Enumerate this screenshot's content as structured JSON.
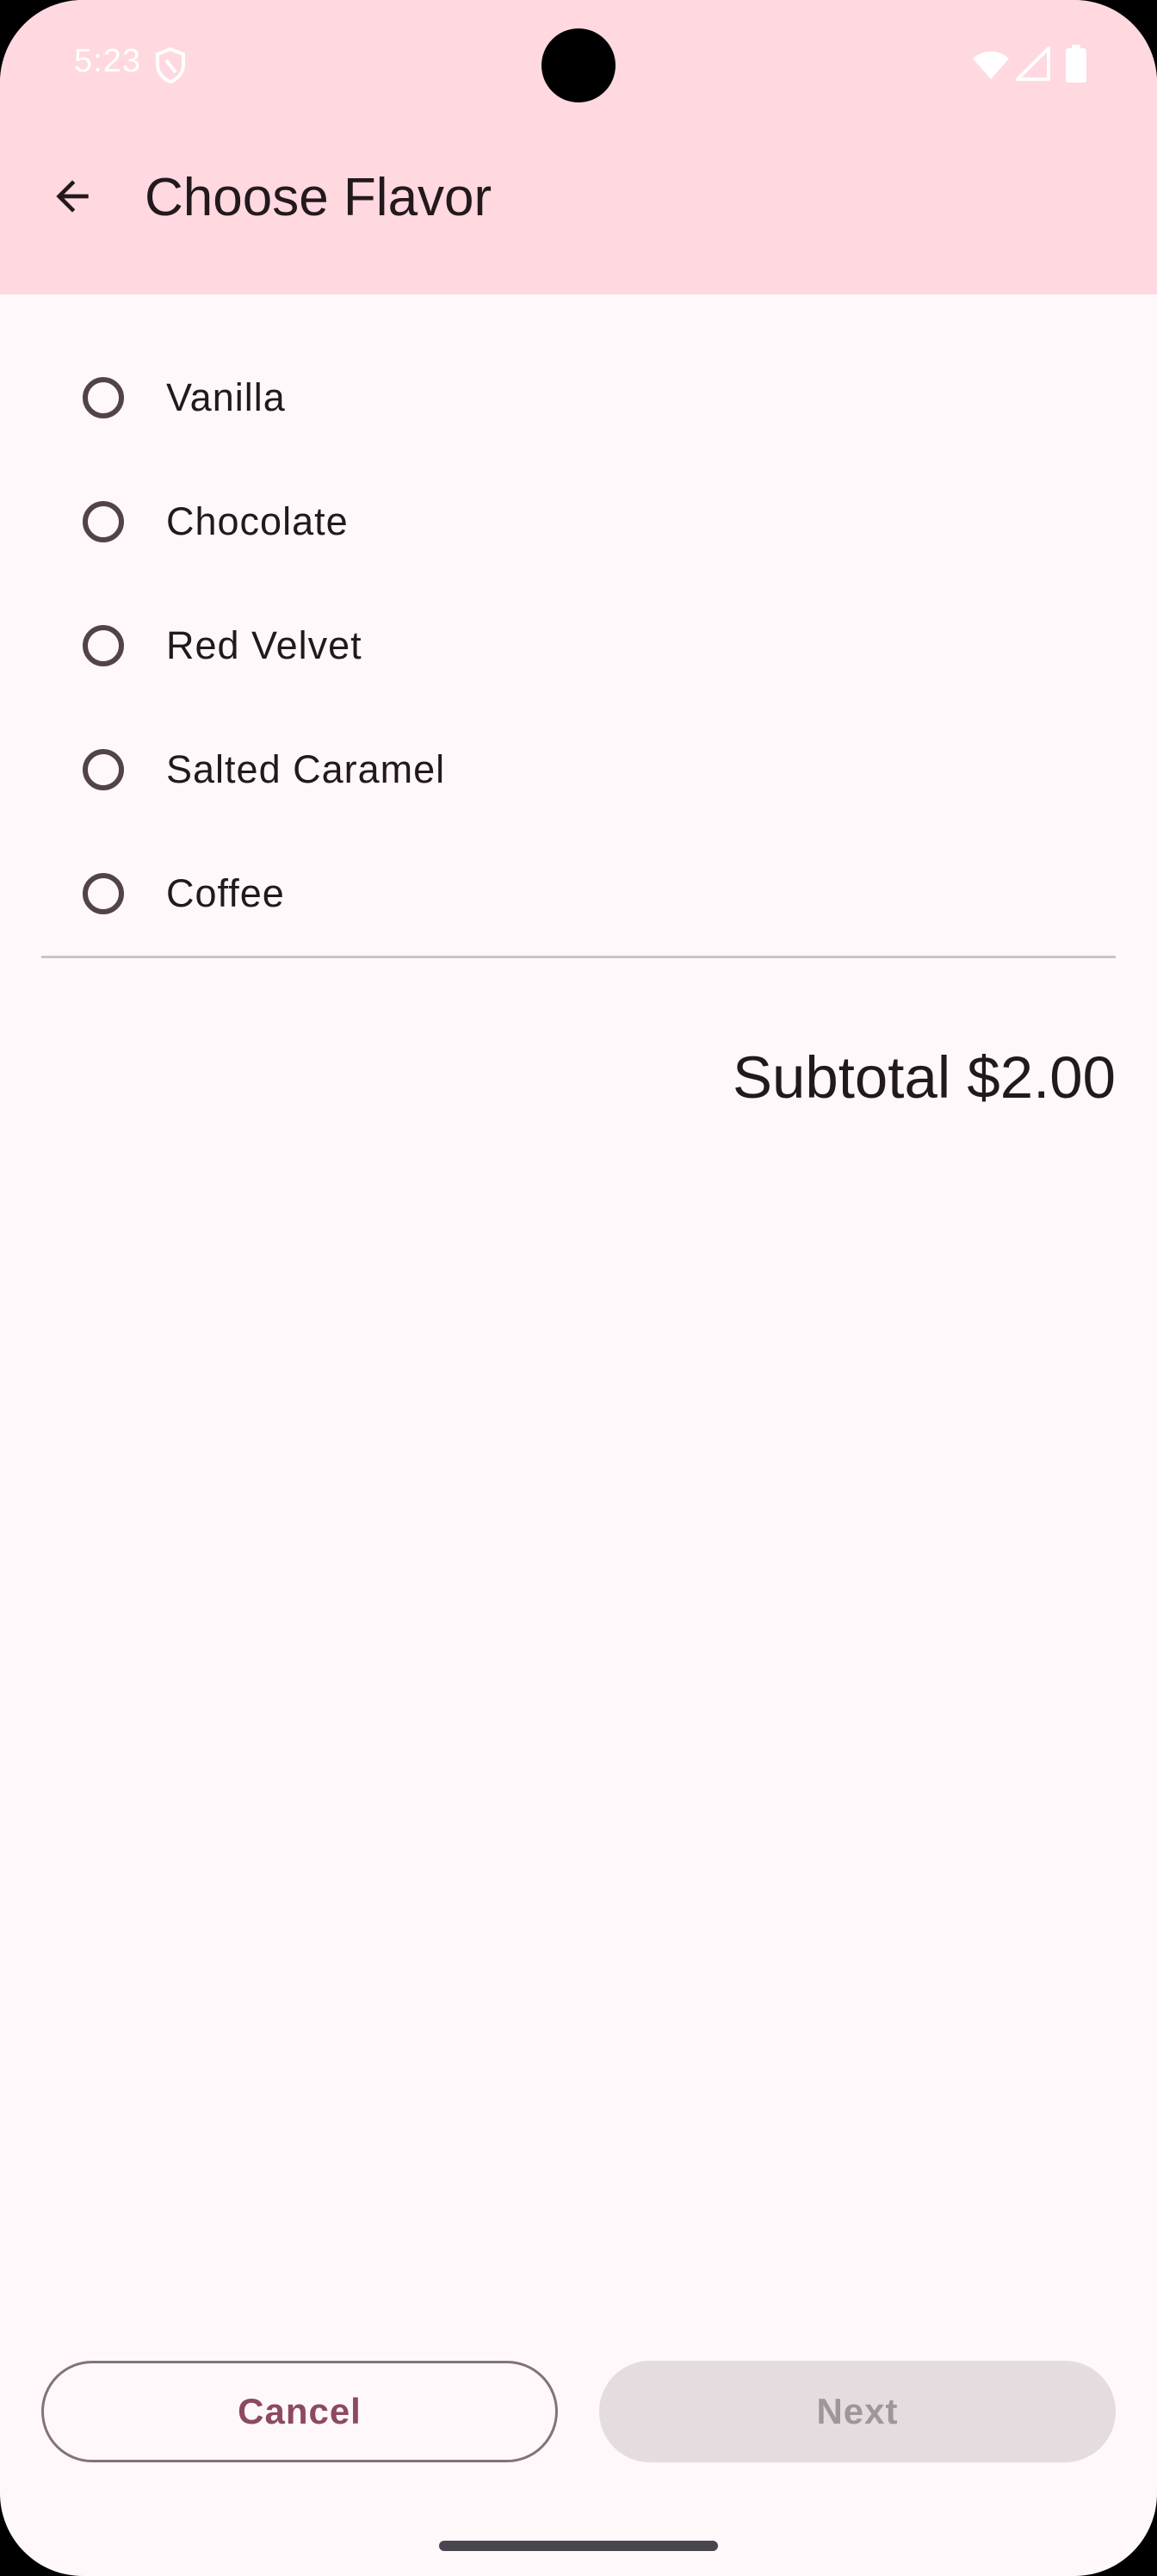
{
  "status_bar": {
    "time": "5:23"
  },
  "app_bar": {
    "title": "Choose Flavor",
    "back_icon": "arrow-back-icon"
  },
  "flavors": [
    {
      "label": "Vanilla",
      "selected": false
    },
    {
      "label": "Chocolate",
      "selected": false
    },
    {
      "label": "Red Velvet",
      "selected": false
    },
    {
      "label": "Salted Caramel",
      "selected": false
    },
    {
      "label": "Coffee",
      "selected": false
    }
  ],
  "subtotal": {
    "text": "Subtotal $2.00"
  },
  "buttons": {
    "cancel_label": "Cancel",
    "next_label": "Next",
    "next_enabled": false
  },
  "colors": {
    "top_bar": "#FFD8E0",
    "background": "#FFF8FB",
    "primary": "#8C4A60",
    "on_surface": "#22191C",
    "disabled_container": "#E4DCDF"
  }
}
